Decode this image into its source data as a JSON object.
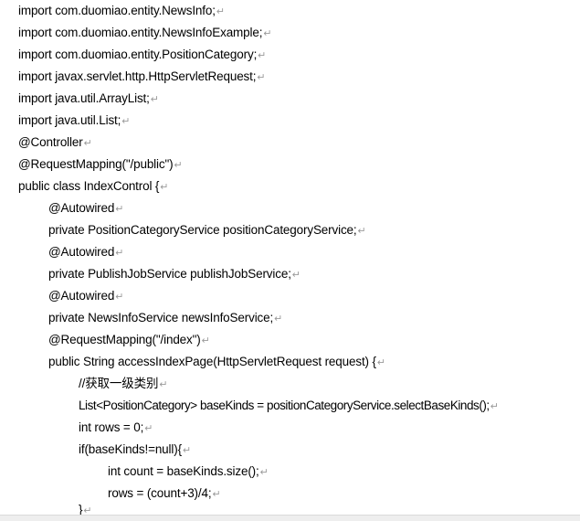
{
  "document": {
    "paragraph_mark": "↵",
    "lines": [
      "import com.duomiao.entity.NewsInfo;",
      "import com.duomiao.entity.NewsInfoExample;",
      "import com.duomiao.entity.PositionCategory;",
      "import javax.servlet.http.HttpServletRequest;",
      "import java.util.ArrayList;",
      "import java.util.List;",
      "@Controller",
      "@RequestMapping(\"/public\")",
      "public class IndexControl {",
      "@Autowired",
      "private PositionCategoryService positionCategoryService;",
      "@Autowired",
      "private PublishJobService publishJobService;",
      "@Autowired",
      "private NewsInfoService newsInfoService;",
      "@RequestMapping(\"/index\")",
      "public String accessIndexPage(HttpServletRequest request) {",
      "//获取一级类别",
      "List<PositionCategory> baseKinds = positionCategoryService.selectBaseKinds();",
      "int rows = 0;",
      "if(baseKinds!=null){",
      "int count = baseKinds.size();",
      "rows = (count+3)/4;",
      "}"
    ]
  }
}
